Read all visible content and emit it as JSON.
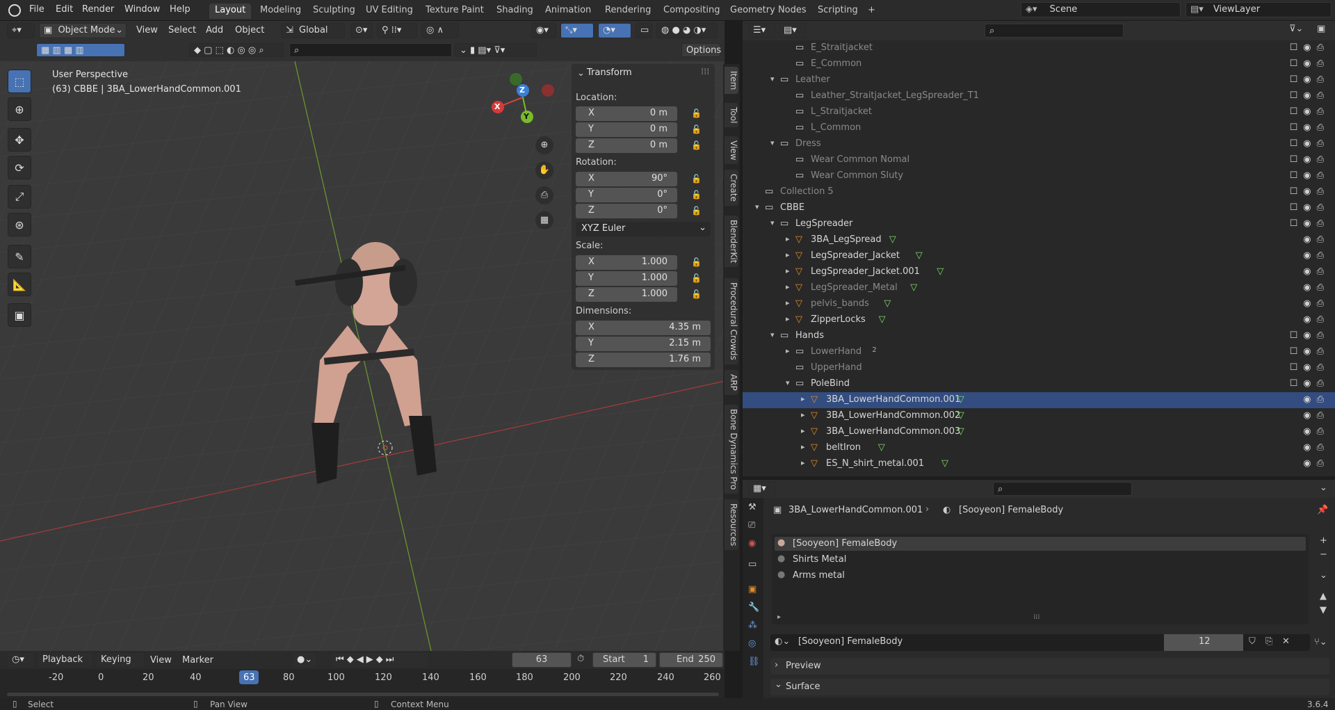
{
  "menu": [
    "File",
    "Edit",
    "Render",
    "Window",
    "Help"
  ],
  "workspaces": [
    "Layout",
    "Modeling",
    "Sculpting",
    "UV Editing",
    "Texture Paint",
    "Shading",
    "Animation",
    "Rendering",
    "Compositing",
    "Geometry Nodes",
    "Scripting"
  ],
  "active_workspace": "Layout",
  "add_workspace": "+",
  "scene": {
    "label": "Scene",
    "viewlayer": "ViewLayer"
  },
  "viewport_header": {
    "mode": "Object Mode",
    "menus": [
      "View",
      "Select",
      "Add",
      "Object"
    ],
    "orientation": "Global",
    "options": "Options"
  },
  "viewport": {
    "perspective": "User Perspective",
    "object_info": "(63) CBBE | 3BA_LowerHandCommon.001"
  },
  "npanel": {
    "title": "Transform",
    "location_label": "Location:",
    "rotation_label": "Rotation:",
    "scale_label": "Scale:",
    "dimensions_label": "Dimensions:",
    "location": [
      {
        "ax": "X",
        "val": "0 m"
      },
      {
        "ax": "Y",
        "val": "0 m"
      },
      {
        "ax": "Z",
        "val": "0 m"
      }
    ],
    "rotation": [
      {
        "ax": "X",
        "val": "90°"
      },
      {
        "ax": "Y",
        "val": "0°"
      },
      {
        "ax": "Z",
        "val": "0°"
      }
    ],
    "rotation_mode": "XYZ Euler",
    "scale": [
      {
        "ax": "X",
        "val": "1.000"
      },
      {
        "ax": "Y",
        "val": "1.000"
      },
      {
        "ax": "Z",
        "val": "1.000"
      }
    ],
    "dimensions": [
      {
        "ax": "X",
        "val": "4.35 m"
      },
      {
        "ax": "Y",
        "val": "2.15 m"
      },
      {
        "ax": "Z",
        "val": "1.76 m"
      }
    ]
  },
  "sidetabs": [
    "Item",
    "Tool",
    "View",
    "Create",
    "BlenderKit",
    "Procedural Crowds",
    "ARP",
    "Bone Dynamics Pro",
    "Resources"
  ],
  "gizmo": {
    "x": "X",
    "y": "Y",
    "z": "Z"
  },
  "outliner": [
    {
      "name": "E_Straitjacket",
      "indent": 3,
      "dim": true
    },
    {
      "name": "E_Common",
      "indent": 3,
      "dim": true
    },
    {
      "name": "Leather",
      "indent": 2,
      "dim": true,
      "exp": "▾"
    },
    {
      "name": "Leather_Straitjacket_LegSpreader_T1",
      "indent": 3,
      "dim": true
    },
    {
      "name": "L_Straitjacket",
      "indent": 3,
      "dim": true
    },
    {
      "name": "L_Common",
      "indent": 3,
      "dim": true
    },
    {
      "name": "Dress",
      "indent": 2,
      "dim": true,
      "exp": "▾"
    },
    {
      "name": "Wear Common Nomal",
      "indent": 3,
      "dim": true
    },
    {
      "name": "Wear Common Sluty",
      "indent": 3,
      "dim": true
    },
    {
      "name": "Collection 5",
      "indent": 1,
      "dim": true
    },
    {
      "name": "CBBE",
      "indent": 1,
      "dim": false,
      "exp": "▾"
    },
    {
      "name": "LegSpreader",
      "indent": 2,
      "dim": false,
      "exp": "▾"
    },
    {
      "name": "3BA_LegSpread",
      "indent": 3,
      "dim": false,
      "exp": "▸",
      "mesh": true
    },
    {
      "name": "LegSpreader_Jacket",
      "indent": 3,
      "dim": false,
      "exp": "▸",
      "mesh": true
    },
    {
      "name": "LegSpreader_Jacket.001",
      "indent": 3,
      "dim": false,
      "exp": "▸",
      "mesh": true
    },
    {
      "name": "LegSpreader_Metal",
      "indent": 3,
      "dim": true,
      "exp": "▸",
      "mesh": true
    },
    {
      "name": "pelvis_bands",
      "indent": 3,
      "dim": true,
      "exp": "▸",
      "mesh": true
    },
    {
      "name": "ZipperLocks",
      "indent": 3,
      "dim": false,
      "exp": "▸",
      "mesh": true
    },
    {
      "name": "Hands",
      "indent": 2,
      "dim": false,
      "exp": "▾"
    },
    {
      "name": "LowerHand",
      "indent": 3,
      "dim": true,
      "exp": "▸",
      "badge": "2"
    },
    {
      "name": "UpperHand",
      "indent": 3,
      "dim": true
    },
    {
      "name": "PoleBind",
      "indent": 3,
      "dim": false,
      "exp": "▾"
    },
    {
      "name": "3BA_LowerHandCommon.001",
      "indent": 4,
      "dim": false,
      "exp": "▸",
      "mesh": true,
      "sel": true
    },
    {
      "name": "3BA_LowerHandCommon.002",
      "indent": 4,
      "dim": false,
      "exp": "▸",
      "mesh": true
    },
    {
      "name": "3BA_LowerHandCommon.003",
      "indent": 4,
      "dim": false,
      "exp": "▸",
      "mesh": true
    },
    {
      "name": "beltIron",
      "indent": 4,
      "dim": false,
      "exp": "▸",
      "mesh": true
    },
    {
      "name": "ES_N_shirt_metal.001",
      "indent": 4,
      "dim": false,
      "exp": "▸",
      "mesh": true
    }
  ],
  "properties": {
    "breadcrumb_object": "3BA_LowerHandCommon.001",
    "breadcrumb_material": "[Sooyeon] FemaleBody",
    "slots": [
      "[Sooyeon] FemaleBody",
      "Shirts Metal",
      "Arms metal"
    ],
    "material_name": "[Sooyeon] FemaleBody",
    "users": "12",
    "sections": [
      "Preview",
      "Surface"
    ]
  },
  "timeline": {
    "menus": [
      "Playback",
      "Keying",
      "View",
      "Marker"
    ],
    "current_frame": "63",
    "start_label": "Start",
    "start": "1",
    "end_label": "End",
    "end": "250",
    "ticks": [
      "-20",
      "0",
      "20",
      "40",
      "63",
      "80",
      "100",
      "120",
      "140",
      "160",
      "180",
      "200",
      "220",
      "240",
      "260"
    ]
  },
  "status": {
    "select": "Select",
    "pan": "Pan View",
    "context": "Context Menu",
    "version": "3.6.4"
  }
}
